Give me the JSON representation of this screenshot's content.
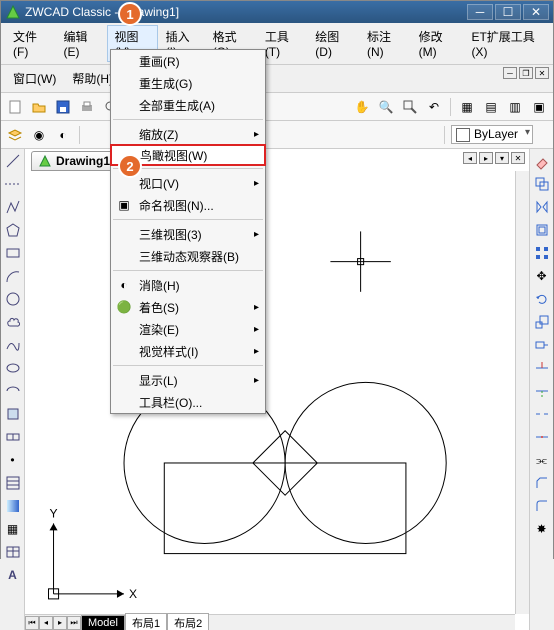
{
  "title": "ZWCAD Classic",
  "doc": "[Drawing1]",
  "menubar": [
    "文件(F)",
    "编辑(E)",
    "视图(V)",
    "插入(I)",
    "格式(O)",
    "工具(T)",
    "绘图(D)",
    "标注(N)",
    "修改(M)",
    "ET扩展工具(X)"
  ],
  "submenubar": [
    "窗口(W)",
    "帮助(H)"
  ],
  "view_menu": {
    "items": [
      {
        "label": "重画(R)"
      },
      {
        "label": "重生成(G)"
      },
      {
        "label": "全部重生成(A)"
      },
      {
        "sep": true
      },
      {
        "label": "缩放(Z)",
        "sub": true
      },
      {
        "label": "鸟瞰视图(W)",
        "hl": true
      },
      {
        "sep": true
      },
      {
        "label": "视口(V)",
        "sub": true
      },
      {
        "label": "命名视图(N)...",
        "icon": "🔲"
      },
      {
        "sep": true
      },
      {
        "label": "三维视图(3)",
        "sub": true
      },
      {
        "label": "三维动态观察器(B)"
      },
      {
        "sep": true
      },
      {
        "label": "消隐(H)",
        "icon": "◐"
      },
      {
        "label": "着色(S)",
        "icon": "🟢",
        "sub": true
      },
      {
        "label": "渲染(E)",
        "sub": true
      },
      {
        "label": "视觉样式(I)",
        "sub": true
      },
      {
        "sep": true
      },
      {
        "label": "显示(L)",
        "sub": true
      },
      {
        "label": "工具栏(O)..."
      }
    ]
  },
  "layer_field": "ByLayer",
  "doctab": "Drawing1",
  "tabs": {
    "model": "Model",
    "layout1": "布局1",
    "layout2": "布局2"
  },
  "axes": {
    "x": "X",
    "y": "Y"
  },
  "badges": {
    "one": "1",
    "two": "2"
  },
  "chart_data": null
}
